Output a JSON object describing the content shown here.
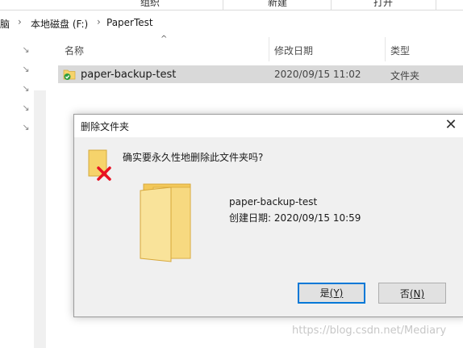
{
  "ribbon": {
    "items": [
      "组织",
      "新建",
      "打开"
    ]
  },
  "address": {
    "crumbs": [
      "脑",
      "本地磁盘 (F:)",
      "PaperTest"
    ]
  },
  "columns": {
    "name": "名称",
    "modified": "修改日期",
    "type": "类型"
  },
  "files": [
    {
      "name": "paper-backup-test",
      "modified": "2020/09/15 11:02",
      "type": "文件夹"
    }
  ],
  "dialog": {
    "title": "删除文件夹",
    "question": "确实要永久性地删除此文件夹吗?",
    "item_name": "paper-backup-test",
    "item_created": "创建日期: 2020/09/15 10:59",
    "yes_label": "是",
    "yes_key": "(Y)",
    "no_label": "否",
    "no_key": "(N)"
  },
  "watermark": "https://blog.csdn.net/Mediary",
  "colors": {
    "accent": "#0078d7",
    "selected_row": "#d9d9d9",
    "folder": "#f6d36b",
    "delete_x": "#e81123"
  },
  "icons": {
    "pin": "pin-icon",
    "folder": "folder-icon",
    "sync": "sync-check-icon",
    "delete": "delete-x-icon",
    "close": "close-icon"
  }
}
